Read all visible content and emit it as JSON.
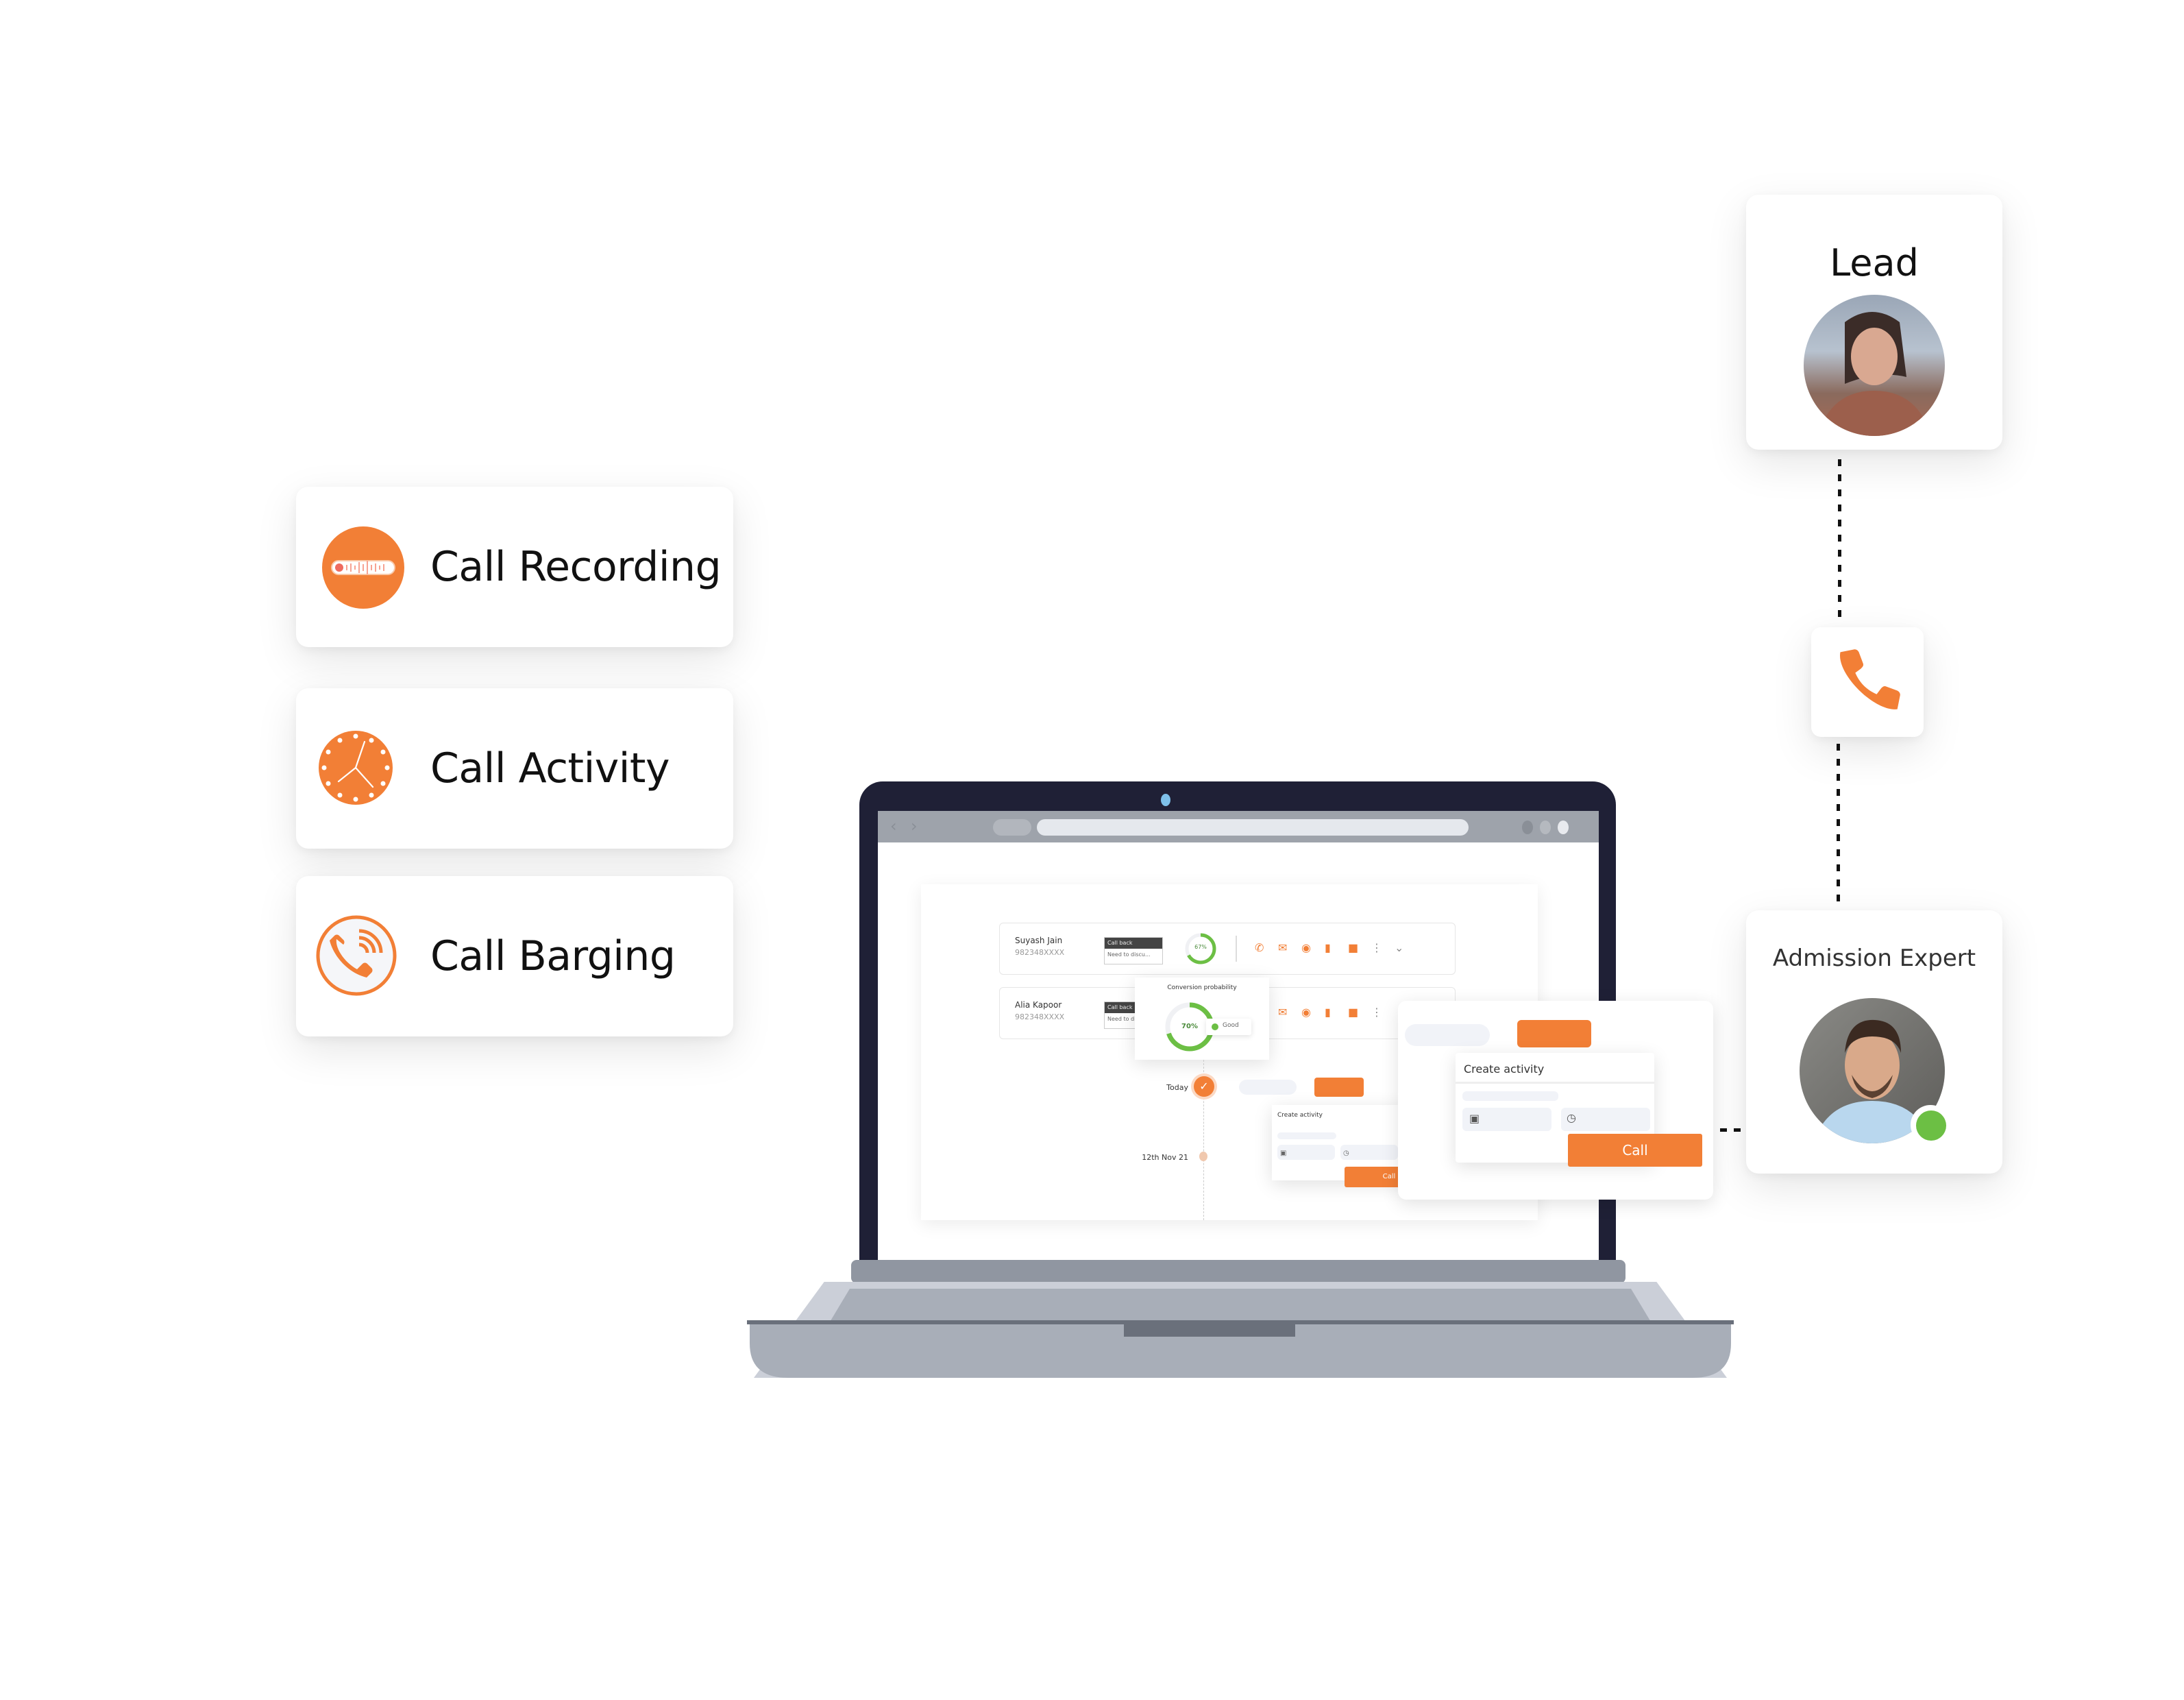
{
  "features": [
    {
      "label": "Call Recording",
      "icon": "audio-waveform-icon"
    },
    {
      "label": "Call Activity",
      "icon": "clock-icon"
    },
    {
      "label": "Call Barging",
      "icon": "phone-signal-icon"
    }
  ],
  "lead_card": {
    "title": "Lead",
    "avatar": "lead-avatar"
  },
  "connector_icon": "phone-icon",
  "expert_card": {
    "title": "Admission Expert",
    "avatar": "expert-avatar",
    "status": "online"
  },
  "colors": {
    "accent": "#f27f36",
    "online": "#6cbf44",
    "progress": "#6cbf44",
    "laptop_bezel": "#1f2036"
  },
  "app": {
    "leads": [
      {
        "name": "Suyash Jain",
        "phone": "982348XXXX",
        "note_title": "Call back",
        "note_body": "Need to discu...",
        "conversion": "67%",
        "conversion_value": 0.67
      },
      {
        "name": "Alia Kapoor",
        "phone": "982348XXXX",
        "note_title": "Call back",
        "note_body": "Need to discu...",
        "conversion": "70%",
        "conversion_value": 0.7
      }
    ],
    "action_icons": [
      "phone-icon",
      "email-icon",
      "whatsapp-icon",
      "chat-icon",
      "video-icon",
      "more-icon",
      "chevron-down-icon"
    ],
    "conversion_popup": {
      "title": "Conversion probability",
      "value": "70%",
      "rating": "Good"
    },
    "timeline": [
      {
        "label": "Today",
        "state": "done"
      },
      {
        "label": "12th Nov 21",
        "state": "pending"
      }
    ],
    "create_activity": {
      "title": "Create activity",
      "call_label": "Call"
    }
  }
}
